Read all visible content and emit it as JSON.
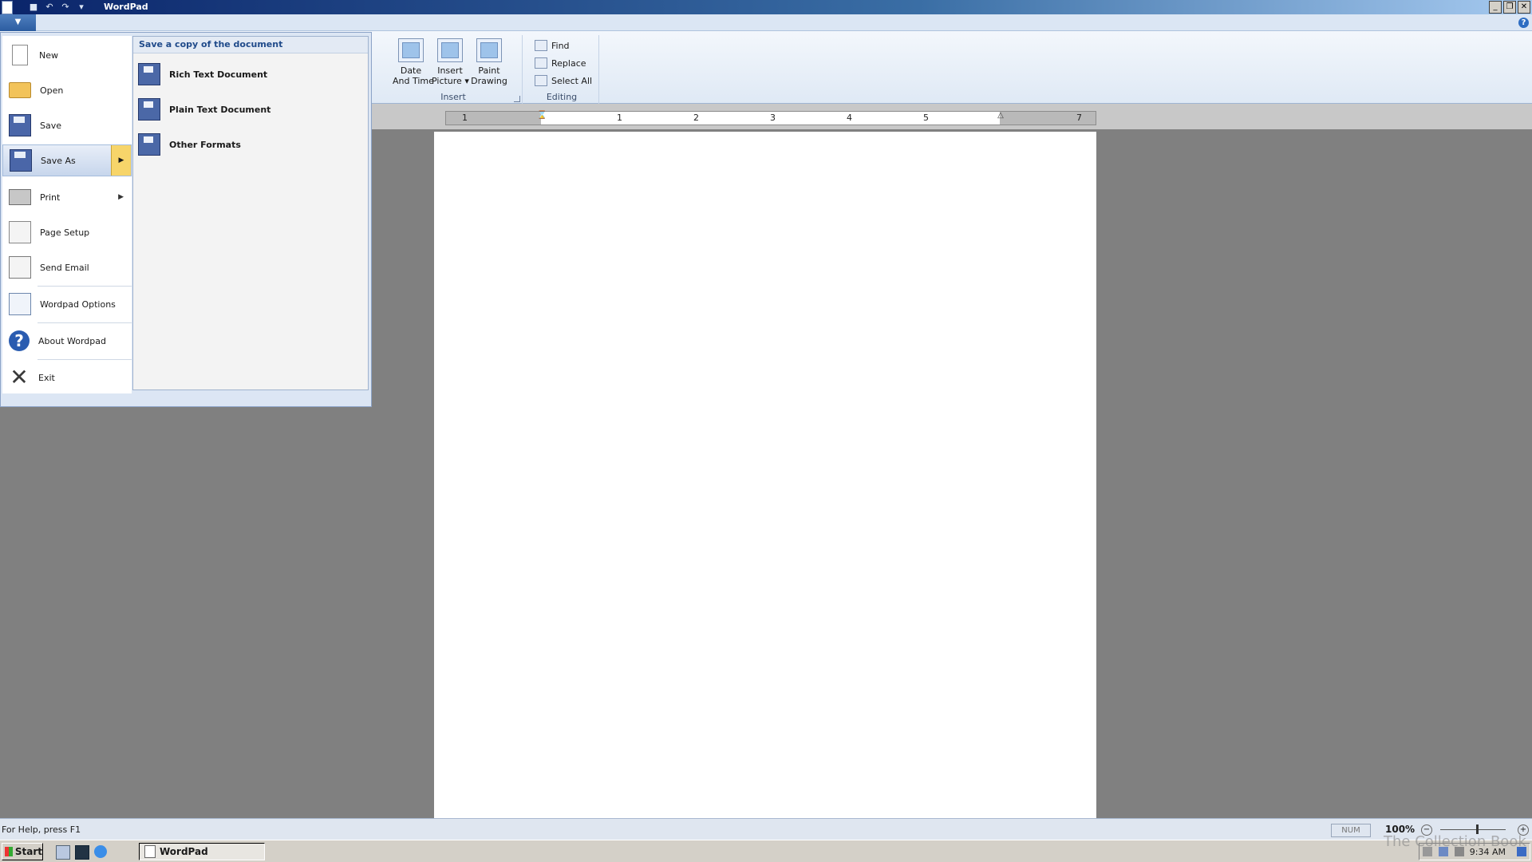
{
  "window": {
    "title": "WordPad",
    "quick_access": [
      "save-icon",
      "undo-icon",
      "redo-icon",
      "customize-icon"
    ],
    "controls": [
      "_",
      "❐",
      "✕"
    ]
  },
  "ribbon": {
    "help": "?",
    "insert_group": {
      "label": "Insert",
      "buttons": [
        {
          "label": "Date\nAnd Time",
          "icon": "calendar-clock-icon"
        },
        {
          "label": "Insert\nPicture ▾",
          "icon": "picture-icon"
        },
        {
          "label": "Paint\nDrawing",
          "icon": "paint-icon"
        }
      ]
    },
    "editing_group": {
      "label": "Editing",
      "buttons": [
        {
          "label": "Find",
          "icon": "binoculars-icon"
        },
        {
          "label": "Replace",
          "icon": "replace-icon"
        },
        {
          "label": "Select All",
          "icon": "select-all-icon"
        }
      ]
    }
  },
  "ruler": {
    "numbers": [
      "1",
      "1",
      "2",
      "3",
      "4",
      "5",
      "7"
    ]
  },
  "app_menu": {
    "items": [
      {
        "label": "New",
        "icon": "new-document-icon"
      },
      {
        "label": "Open",
        "icon": "open-folder-icon"
      },
      {
        "label": "Save",
        "icon": "save-icon"
      },
      {
        "label": "Save As",
        "icon": "save-as-icon",
        "submenu": true,
        "active": true
      },
      {
        "label": "Print",
        "icon": "printer-icon",
        "submenu": true
      },
      {
        "label": "Page Setup",
        "icon": "page-setup-icon"
      },
      {
        "label": "Send Email",
        "icon": "email-icon"
      },
      {
        "label": "Wordpad Options",
        "icon": "options-icon"
      },
      {
        "label": "About Wordpad",
        "icon": "help-icon"
      },
      {
        "label": "Exit",
        "icon": "exit-icon"
      }
    ],
    "submenu": {
      "header": "Save a copy of the document",
      "items": [
        {
          "label": "Rich Text Document",
          "icon": "rtf-save-icon"
        },
        {
          "label": "Plain Text Document",
          "icon": "txt-save-icon"
        },
        {
          "label": "Other Formats",
          "icon": "other-formats-icon"
        }
      ]
    }
  },
  "statusbar": {
    "help_text": "For Help, press F1",
    "num": "NUM",
    "zoom": "100%",
    "zoom_out": "−",
    "zoom_in": "+"
  },
  "taskbar": {
    "start": "Start",
    "task": "WordPad",
    "clock": "9:34 AM"
  },
  "watermark": "The Collection Book"
}
